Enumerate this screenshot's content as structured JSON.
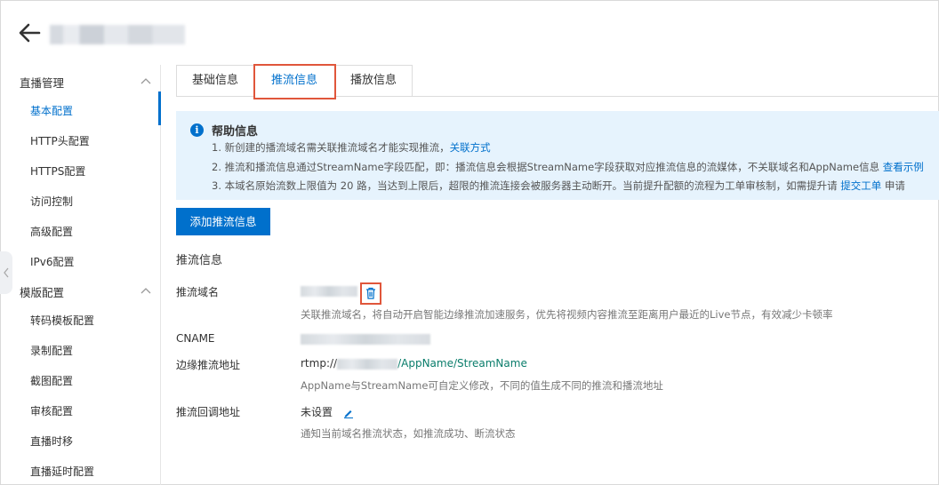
{
  "header": {
    "back_icon": "arrow-left-icon"
  },
  "sidebar": {
    "groups": [
      {
        "label": "直播管理",
        "items": [
          "基本配置",
          "HTTP头配置",
          "HTTPS配置",
          "访问控制",
          "高级配置",
          "IPv6配置"
        ]
      },
      {
        "label": "模版配置",
        "items": [
          "转码模板配置",
          "录制配置",
          "截图配置",
          "审核配置",
          "直播时移",
          "直播延时配置"
        ]
      }
    ],
    "active_item": "基本配置"
  },
  "tabs": [
    "基础信息",
    "推流信息",
    "播放信息"
  ],
  "active_tab": "推流信息",
  "help": {
    "title": "帮助信息",
    "line1": "1. 新创建的播流域名需关联推流域名才能实现推流，",
    "line1_link": "关联方式",
    "line2": "2. 推流和播流信息通过StreamName字段匹配，即：播流信息会根据StreamName字段获取对应推流信息的流媒体，不关联域名和AppName信息 ",
    "line2_link": "查看示例",
    "line3": "3. 本域名原始流数上限值为 20 路，当达到上限后，超限的推流连接会被服务器主动断开。当前提升配额的流程为工单审核制，如需提升请 ",
    "line3_link": "提交工单",
    "line3_tail": " 申请"
  },
  "add_button": "添加推流信息",
  "section_title": "推流信息",
  "fields": {
    "push_domain_label": "推流域名",
    "push_domain_hint": "关联推流域名，将自动开启智能边缘推流加速服务，优先将视频内容推流至距离用户最近的Live节点，有效减少卡顿率",
    "cname_label": "CNAME",
    "edge_label": "边缘推流地址",
    "edge_prefix": "rtmp://",
    "edge_suffix": "/AppName/StreamName",
    "edge_hint": "AppName与StreamName可自定义修改，不同的值生成不同的推流和播流地址",
    "callback_label": "推流回调地址",
    "callback_value": "未设置",
    "callback_hint": "通知当前域名推流状态，如推流成功、断流状态"
  },
  "colors": {
    "accent": "#0070cc",
    "highlight": "#e0563b",
    "help_bg": "#e6f3fd"
  }
}
